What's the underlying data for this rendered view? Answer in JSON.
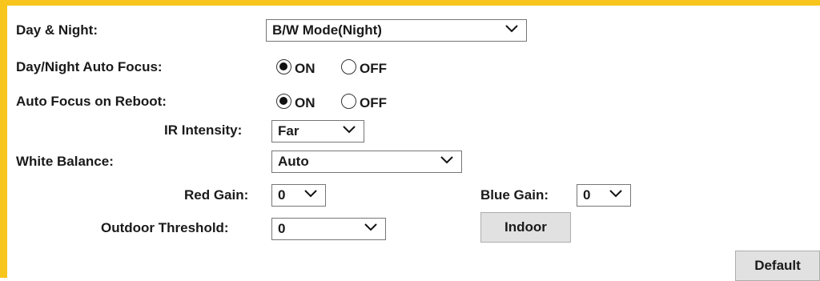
{
  "colors": {
    "accent": "#f7c51c"
  },
  "day_night": {
    "label": "Day & Night:",
    "value": "B/W Mode(Night)"
  },
  "auto_focus": {
    "label": "Day/Night Auto Focus:",
    "on_label": "ON",
    "off_label": "OFF",
    "selected": "ON"
  },
  "reboot_focus": {
    "label": "Auto Focus on Reboot:",
    "on_label": "ON",
    "off_label": "OFF",
    "selected": "ON"
  },
  "ir_intensity": {
    "label": "IR Intensity:",
    "value": "Far"
  },
  "white_balance": {
    "label": "White Balance:",
    "value": "Auto"
  },
  "red_gain": {
    "label": "Red Gain:",
    "value": "0"
  },
  "blue_gain": {
    "label": "Blue Gain:",
    "value": "0"
  },
  "outdoor_threshold": {
    "label": "Outdoor Threshold:",
    "value": "0"
  },
  "buttons": {
    "indoor": "Indoor",
    "default": "Default"
  },
  "icons": {
    "dropdown": "chevron-down-icon",
    "radio": "radio-icon"
  }
}
